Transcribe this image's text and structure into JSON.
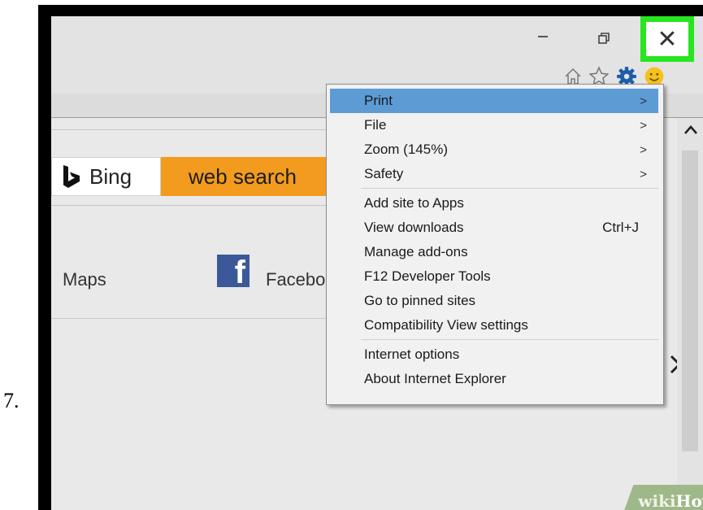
{
  "step": {
    "number": "7."
  },
  "window": {
    "minimize_glyph": "−",
    "close_glyph": "✕"
  },
  "toolbar": {
    "icons": [
      "home-icon",
      "star-icon",
      "gear-icon",
      "smiley-icon"
    ]
  },
  "page": {
    "bing_label": "Bing",
    "search_button": "web search",
    "maps_link": "Maps",
    "facebook_link": "Facebo",
    "facebook_logo_letter": "f"
  },
  "menu": {
    "groups": [
      [
        {
          "label": "Print",
          "arrow": ">",
          "selected": true
        },
        {
          "label": "File",
          "arrow": ">"
        },
        {
          "label": "Zoom (145%)",
          "arrow": ">"
        },
        {
          "label": "Safety",
          "arrow": ">"
        }
      ],
      [
        {
          "label": "Add site to Apps"
        },
        {
          "label": "View downloads",
          "shortcut": "Ctrl+J"
        },
        {
          "label": "Manage add-ons"
        },
        {
          "label": "F12 Developer Tools"
        },
        {
          "label": "Go to pinned sites"
        },
        {
          "label": "Compatibility View settings"
        }
      ],
      [
        {
          "label": "Internet options"
        },
        {
          "label": "About Internet Explorer"
        }
      ]
    ]
  },
  "watermark": {
    "wiki": "wiki",
    "how": "How"
  },
  "colors": {
    "highlight_box": "#27e51f",
    "menu_selected": "#5d9bd5",
    "search_button": "#f29b1e",
    "facebook": "#3b5998",
    "gear": "#1e5ea8",
    "smiley": "#f3c21b"
  }
}
